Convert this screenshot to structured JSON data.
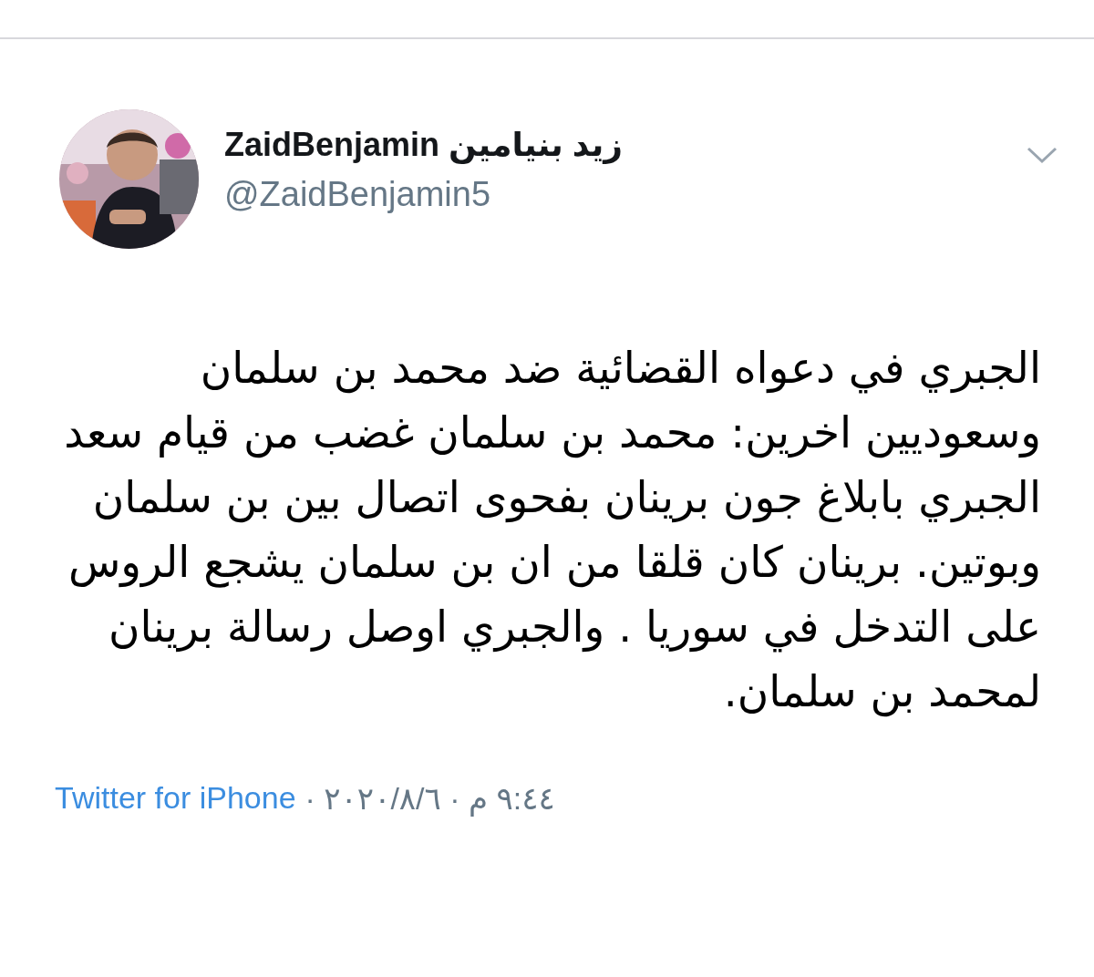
{
  "tweet": {
    "author_name": "ZaidBenjamin زيد بنيامين",
    "author_handle": "@ZaidBenjamin5",
    "text": "الجبري في دعواه القضائية ضد محمد بن سلمان وسعوديين اخرين: محمد بن سلمان غضب من قيام سعد الجبري بابلاغ جون برينان بفحوى اتصال بين بن سلمان وبوتين. برينان كان قلقا من ان بن سلمان يشجع الروس على التدخل في سوريا . والجبري اوصل رسالة برينان لمحمد بن سلمان.",
    "timestamp": "٩:٤٤ م · ٢٠٢٠/٨/٦ ·",
    "source": "Twitter for iPhone"
  }
}
